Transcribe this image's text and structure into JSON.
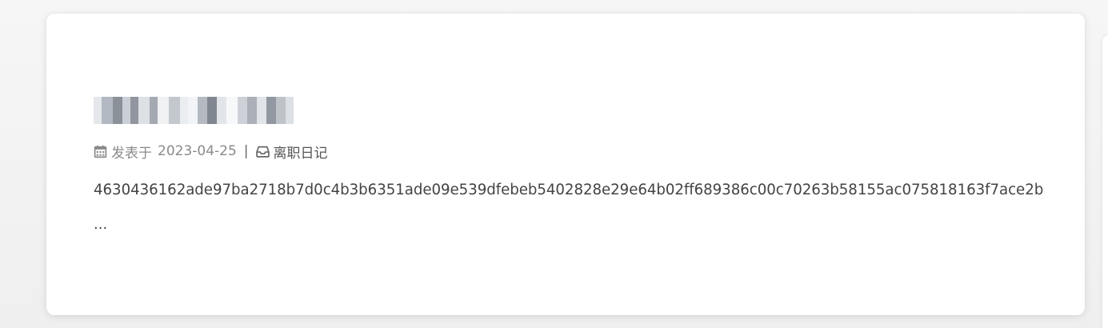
{
  "post": {
    "title": "",
    "meta": {
      "posted_label": "发表于",
      "date": "2023-04-25",
      "separator": "|",
      "category": "离职日记",
      "calendar_icon": "calendar-icon",
      "category_icon": "inbox-icon"
    },
    "excerpt": "4630436162ade97ba2718b7d0c4b3b6351ade09e539dfebeb5402828e29e64b02ff689386c00c70263b58155ac075818163f7ace2b",
    "more": "..."
  },
  "colors": {
    "background": "#efefef",
    "card": "#ffffff",
    "meta_text": "#8a8a8a",
    "body_text": "#444444"
  }
}
